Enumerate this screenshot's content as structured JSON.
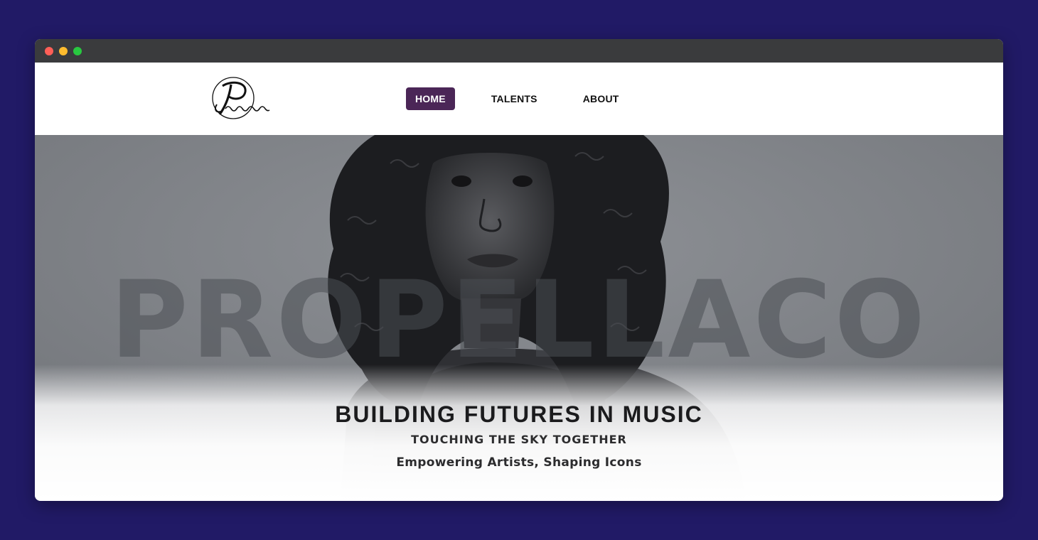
{
  "window": {
    "controls": [
      "close",
      "minimize",
      "maximize"
    ]
  },
  "header": {
    "logo_icon": "propellaco-logo-icon",
    "nav": [
      {
        "label": "HOME",
        "active": true
      },
      {
        "label": "TALENTS",
        "active": false
      },
      {
        "label": "ABOUT",
        "active": false
      }
    ]
  },
  "hero": {
    "watermark": "PROPELLACO",
    "title": "BUILDING FUTURES IN MUSIC",
    "subtitle": "TOUCHING THE SKY TOGETHER",
    "tagline": "Empowering Artists, Shaping Icons",
    "photo_icon": "artist-portrait-image"
  },
  "colors": {
    "page_background": "#211a66",
    "titlebar": "#3a3b3d",
    "nav_active": "#4b2657",
    "hero_gray": "#85888d"
  }
}
